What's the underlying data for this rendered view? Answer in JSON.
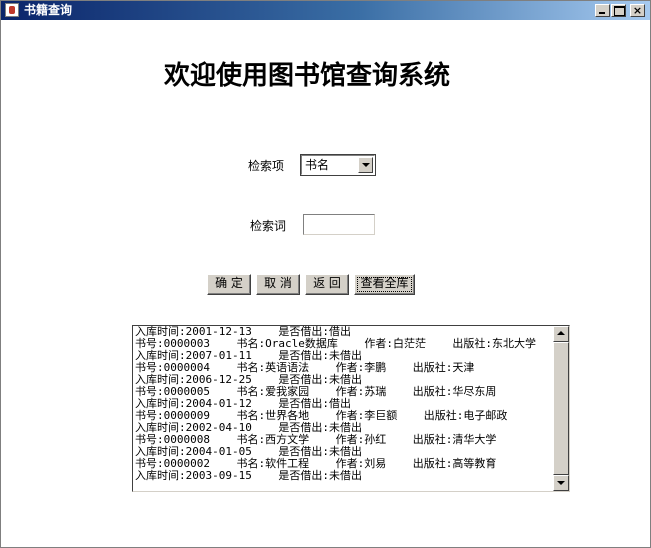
{
  "window": {
    "title": "书籍查询",
    "minimize_icon": "minimize-icon",
    "maximize_icon": "maximize-icon",
    "close_icon": "close-icon",
    "close_symbol": "×"
  },
  "main": {
    "heading": "欢迎使用图书馆查询系统",
    "search_field_label": "检索项",
    "search_field_value": "书名",
    "search_term_label": "检索词",
    "search_term_value": ""
  },
  "buttons": {
    "ok": "确 定",
    "cancel": "取 消",
    "back": "返 回",
    "view_all": "查看全库"
  },
  "results": {
    "lines": [
      "入库时间:2001-12-13    是否借出:借出",
      "书号:0000003    书名:Oracle数据库    作者:白茫茫    出版社:东北大学",
      "入库时间:2007-01-11    是否借出:未借出",
      "书号:0000004    书名:英语语法    作者:李鹏    出版社:天津",
      "入库时间:2006-12-25    是否借出:未借出",
      "书号:0000005    书名:爱我家园    作者:苏瑞    出版社:华尽东周",
      "入库时间:2004-01-12    是否借出:借出",
      "书号:0000009    书名:世界各地    作者:李巨额    出版社:电子邮政",
      "入库时间:2002-04-10    是否借出:未借出",
      "书号:0000008    书名:西方文学    作者:孙红    出版社:清华大学",
      "入库时间:2004-01-05    是否借出:未借出",
      "书号:0000002    书名:软件工程    作者:刘易    出版社:高等教育",
      "入库时间:2003-09-15    是否借出:未借出"
    ]
  }
}
